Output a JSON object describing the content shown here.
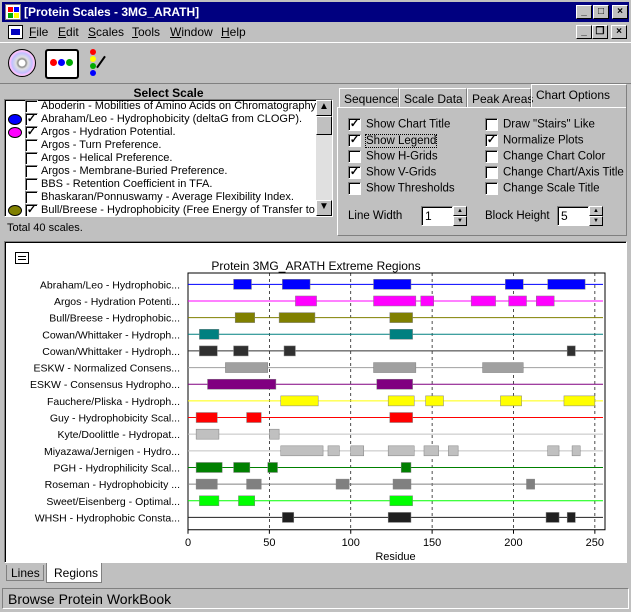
{
  "window": {
    "title": "[Protein Scales - 3MG_ARATH]"
  },
  "menu": [
    "File",
    "Edit",
    "Scales",
    "Tools",
    "Window",
    "Help"
  ],
  "toolbar": {
    "icons": [
      "cd-disc-icon",
      "protein-chain-icon",
      "magic-wand-icon"
    ]
  },
  "select_scale": {
    "heading": "Select Scale",
    "items": [
      {
        "label": "Aboderin - Mobilities of Amino Acids on Chromatography Paper",
        "checked": false,
        "color": ""
      },
      {
        "label": "Abraham/Leo - Hydrophobicity (deltaG from CLOGP).",
        "checked": true,
        "color": "#0000ff"
      },
      {
        "label": "Argos - Hydration Potential.",
        "checked": true,
        "color": "#ff00ff"
      },
      {
        "label": "Argos - Turn Preference.",
        "checked": false,
        "color": ""
      },
      {
        "label": "Argos - Helical Preference.",
        "checked": false,
        "color": ""
      },
      {
        "label": "Argos - Membrane-Buried Preference.",
        "checked": false,
        "color": ""
      },
      {
        "label": "BBS - Retention Coefficient in TFA.",
        "checked": false,
        "color": ""
      },
      {
        "label": "Bhaskaran/Ponnuswamy - Average Flexibility Index.",
        "checked": false,
        "color": ""
      },
      {
        "label": "Bull/Breese - Hydrophobicity (Free Energy of Transfer to Surface",
        "checked": true,
        "color": "#808000"
      }
    ],
    "total": "Total 40 scales."
  },
  "tabs": [
    "Sequence",
    "Scale Data",
    "Peak Areas",
    "Chart Options"
  ],
  "active_tab": "Chart Options",
  "chart_options": {
    "left": [
      {
        "label": "Show Chart Title",
        "checked": true
      },
      {
        "label": "Show Legend",
        "checked": true
      },
      {
        "label": "Show H-Grids",
        "checked": false
      },
      {
        "label": "Show V-Grids",
        "checked": true
      },
      {
        "label": "Show Thresholds",
        "checked": false
      }
    ],
    "right": [
      {
        "label": "Draw \"Stairs\" Like",
        "checked": false
      },
      {
        "label": "Normalize Plots",
        "checked": true
      },
      {
        "label": "Change Chart Color",
        "checked": false
      },
      {
        "label": "Change Chart/Axis Title",
        "checked": false
      },
      {
        "label": "Change Scale Title",
        "checked": false
      }
    ],
    "line_width_label": "Line Width",
    "line_width_value": "1",
    "block_height_label": "Block Height",
    "block_height_value": "5"
  },
  "chart_data": {
    "type": "bar",
    "title": "Protein 3MG_ARATH Extreme Regions",
    "xlabel": "Residue",
    "xlim": [
      0,
      255
    ],
    "xticks": [
      0,
      50,
      100,
      150,
      200,
      250
    ],
    "series": [
      {
        "name": "Abraham/Leo - Hydrophobic...",
        "color": "#0000ff",
        "blocks": [
          [
            28,
            39
          ],
          [
            58,
            75
          ],
          [
            114,
            137
          ],
          [
            195,
            206
          ],
          [
            221,
            244
          ]
        ]
      },
      {
        "name": "Argos - Hydration Potenti...",
        "color": "#ff00ff",
        "blocks": [
          [
            66,
            79
          ],
          [
            114,
            140
          ],
          [
            143,
            151
          ],
          [
            174,
            189
          ],
          [
            197,
            208
          ],
          [
            214,
            225
          ]
        ]
      },
      {
        "name": "Bull/Breese - Hydrophobic...",
        "color": "#808000",
        "blocks": [
          [
            29,
            41
          ],
          [
            56,
            78
          ],
          [
            124,
            138
          ]
        ]
      },
      {
        "name": "Cowan/Whittaker - Hydroph...",
        "color": "#008080",
        "blocks": [
          [
            7,
            19
          ],
          [
            124,
            138
          ]
        ]
      },
      {
        "name": "Cowan/Whittaker - Hydroph...",
        "color": "#303030",
        "blocks": [
          [
            7,
            18
          ],
          [
            28,
            37
          ],
          [
            59,
            66
          ],
          [
            233,
            238
          ]
        ]
      },
      {
        "name": "ESKW - Normalized Consens...",
        "color": "#a0a0a0",
        "blocks": [
          [
            23,
            49
          ],
          [
            114,
            140
          ],
          [
            181,
            206
          ]
        ]
      },
      {
        "name": "ESKW - Consensus Hydropho...",
        "color": "#800080",
        "blocks": [
          [
            12,
            54
          ],
          [
            116,
            138
          ]
        ]
      },
      {
        "name": "Fauchere/Pliska - Hydroph...",
        "color": "#ffff00",
        "blocks": [
          [
            57,
            80
          ],
          [
            123,
            139
          ],
          [
            146,
            157
          ],
          [
            192,
            205
          ],
          [
            231,
            250
          ]
        ]
      },
      {
        "name": "Guy - Hydrophobicity Scal...",
        "color": "#ff0000",
        "blocks": [
          [
            5,
            18
          ],
          [
            36,
            45
          ],
          [
            124,
            138
          ]
        ]
      },
      {
        "name": "Kyte/Doolittle - Hydropat...",
        "color": "#c0c0c0",
        "blocks": [
          [
            5,
            19
          ],
          [
            50,
            56
          ]
        ]
      },
      {
        "name": "Miyazawa/Jernigen - Hydro...",
        "color": "#c0c0c0",
        "blocks": [
          [
            57,
            83
          ],
          [
            86,
            93
          ],
          [
            100,
            108
          ],
          [
            123,
            139
          ],
          [
            145,
            154
          ],
          [
            160,
            166
          ],
          [
            221,
            228
          ],
          [
            236,
            241
          ]
        ]
      },
      {
        "name": "PGH - Hydrophilicity Scal...",
        "color": "#008000",
        "blocks": [
          [
            5,
            21
          ],
          [
            28,
            38
          ],
          [
            49,
            55
          ],
          [
            131,
            137
          ]
        ]
      },
      {
        "name": "Roseman - Hydrophobicity ...",
        "color": "#808080",
        "blocks": [
          [
            5,
            18
          ],
          [
            36,
            45
          ],
          [
            91,
            99
          ],
          [
            126,
            137
          ],
          [
            208,
            213
          ]
        ]
      },
      {
        "name": "Sweet/Eisenberg - Optimal...",
        "color": "#00ff00",
        "blocks": [
          [
            7,
            19
          ],
          [
            31,
            41
          ],
          [
            124,
            138
          ]
        ]
      },
      {
        "name": "WHSH - Hydrophobic Consta...",
        "color": "#202020",
        "blocks": [
          [
            58,
            65
          ],
          [
            123,
            137
          ],
          [
            220,
            228
          ],
          [
            233,
            238
          ]
        ]
      }
    ]
  },
  "bottom_tabs": [
    "Lines",
    "Regions"
  ],
  "status": "Browse Protein WorkBook"
}
